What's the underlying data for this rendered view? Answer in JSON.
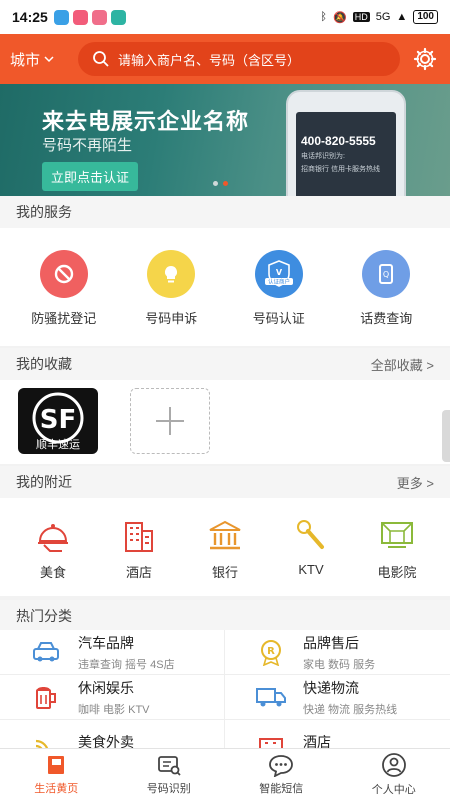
{
  "status_bar": {
    "time": "14:25",
    "signal": "5G",
    "battery": "100"
  },
  "header": {
    "city_label": "城市",
    "search_placeholder": "请输入商户名、号码（含区号）"
  },
  "banner": {
    "title": "来去电展示企业名称",
    "subtitle": "号码不再陌生",
    "button": "立即点击认证",
    "phone_number": "400-820-5555",
    "phone_line1": "电话邦识别为:",
    "phone_line2": "招商银行  信用卡服务热线"
  },
  "services": {
    "title": "我的服务",
    "items": [
      {
        "label": "防骚扰登记",
        "icon": "block-icon",
        "color": "#f06060"
      },
      {
        "label": "号码申诉",
        "icon": "lightbulb-icon",
        "color": "#f5d54a"
      },
      {
        "label": "号码认证",
        "icon": "shield-badge-icon",
        "color": "#3e8de0",
        "badge": "认证商户"
      },
      {
        "label": "话费查询",
        "icon": "phone-bill-icon",
        "color": "#6f9ee6"
      }
    ]
  },
  "favorites": {
    "title": "我的收藏",
    "more": "全部收藏 >",
    "items": [
      {
        "label": "SF",
        "sub": "顺丰速运"
      }
    ]
  },
  "nearby": {
    "title": "我的附近",
    "more": "更多 >",
    "items": [
      {
        "label": "美食",
        "icon": "food-cloche-icon"
      },
      {
        "label": "酒店",
        "icon": "building-icon"
      },
      {
        "label": "银行",
        "icon": "bank-icon"
      },
      {
        "label": "KTV",
        "icon": "microphone-icon"
      },
      {
        "label": "电影院",
        "icon": "cinema-screen-icon"
      }
    ]
  },
  "hot": {
    "title": "热门分类",
    "items": [
      {
        "title": "汽车品牌",
        "sub": "违章查询 摇号 4S店",
        "icon": "car-icon"
      },
      {
        "title": "品牌售后",
        "sub": "家电 数码 服务",
        "icon": "registered-medal-icon"
      },
      {
        "title": "休闲娱乐",
        "sub": "咖啡 电影 KTV",
        "icon": "beer-icon"
      },
      {
        "title": "快递物流",
        "sub": "快递 物流 服务热线",
        "icon": "truck-icon"
      },
      {
        "title": "美食外卖",
        "sub": "",
        "icon": "wifi-food-icon"
      },
      {
        "title": "酒店",
        "sub": "",
        "icon": "hotel-icon"
      }
    ]
  },
  "bottom_nav": [
    {
      "label": "生活黄页",
      "icon": "book-icon",
      "active": true
    },
    {
      "label": "号码识别",
      "icon": "id-scan-icon",
      "active": false
    },
    {
      "label": "智能短信",
      "icon": "chat-bubble-icon",
      "active": false
    },
    {
      "label": "个人中心",
      "icon": "user-icon",
      "active": false
    }
  ],
  "colors": {
    "brand": "#f0582a",
    "brand_dark": "#e2431a"
  }
}
